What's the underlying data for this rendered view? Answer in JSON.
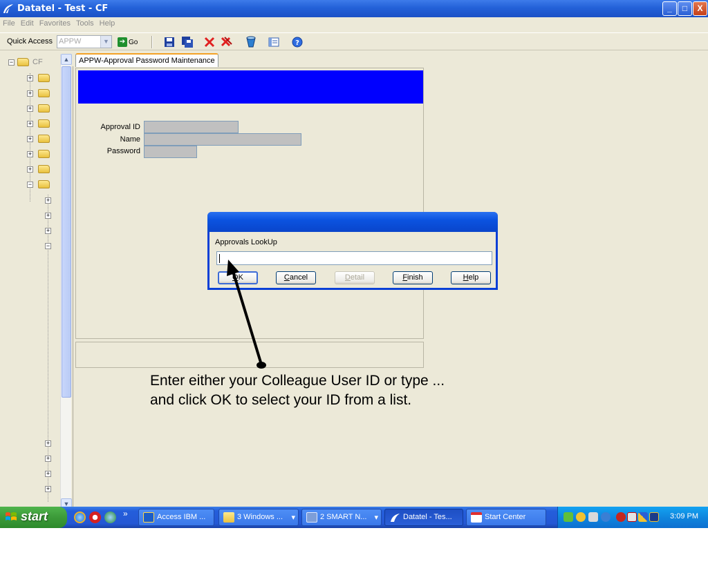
{
  "window": {
    "title": "Datatel - Test - CF",
    "controls": {
      "minimize": "_",
      "maximize": "□",
      "close": "X"
    }
  },
  "menu": [
    "File",
    "Edit",
    "Favorites",
    "Tools",
    "Help"
  ],
  "toolbar": {
    "quick_access_label": "Quick Access",
    "quick_access_value": "APPW",
    "go_label": "Go"
  },
  "tree": {
    "root_label": "CF"
  },
  "tab": {
    "label": "APPW-Approval Password Maintenance"
  },
  "form": {
    "fields": [
      {
        "label": "Approval ID"
      },
      {
        "label": "Name"
      },
      {
        "label": "Password"
      }
    ]
  },
  "dialog": {
    "label": "Approvals LookUp",
    "input_value": "",
    "buttons": [
      {
        "label": "OK",
        "mnemonic": "O",
        "rest": "K",
        "enabled": true
      },
      {
        "label": "Cancel",
        "mnemonic": "C",
        "rest": "ancel",
        "enabled": true
      },
      {
        "label": "Detail",
        "mnemonic": "D",
        "rest": "etail",
        "enabled": false
      },
      {
        "label": "Finish",
        "mnemonic": "F",
        "rest": "inish",
        "enabled": true
      },
      {
        "label": "Help",
        "mnemonic": "H",
        "rest": "elp",
        "enabled": true
      }
    ]
  },
  "annotation": {
    "line1": "Enter either your Colleague User ID or type ...",
    "line2": "and click OK to select your ID from a list."
  },
  "taskbar": {
    "start_label": "start",
    "overflow": "»",
    "buttons": [
      {
        "label": "Access IBM ...",
        "icon": "access-ibm-icon"
      },
      {
        "label": "3 Windows ...",
        "icon": "folder-icon",
        "dropdown": "▾"
      },
      {
        "label": "2 SMART N...",
        "icon": "smart-notebook-icon",
        "dropdown": "▾"
      },
      {
        "label": "Datatel - Tes...",
        "icon": "datatel-icon",
        "active": true
      },
      {
        "label": "Start Center",
        "icon": "start-center-icon"
      }
    ],
    "clock": "3:09 PM"
  },
  "colors": {
    "form_header": "#0000ff",
    "field_bg": "#c0c0c0",
    "window_bg": "#ece9d8",
    "title_blue": "#2361d8"
  }
}
